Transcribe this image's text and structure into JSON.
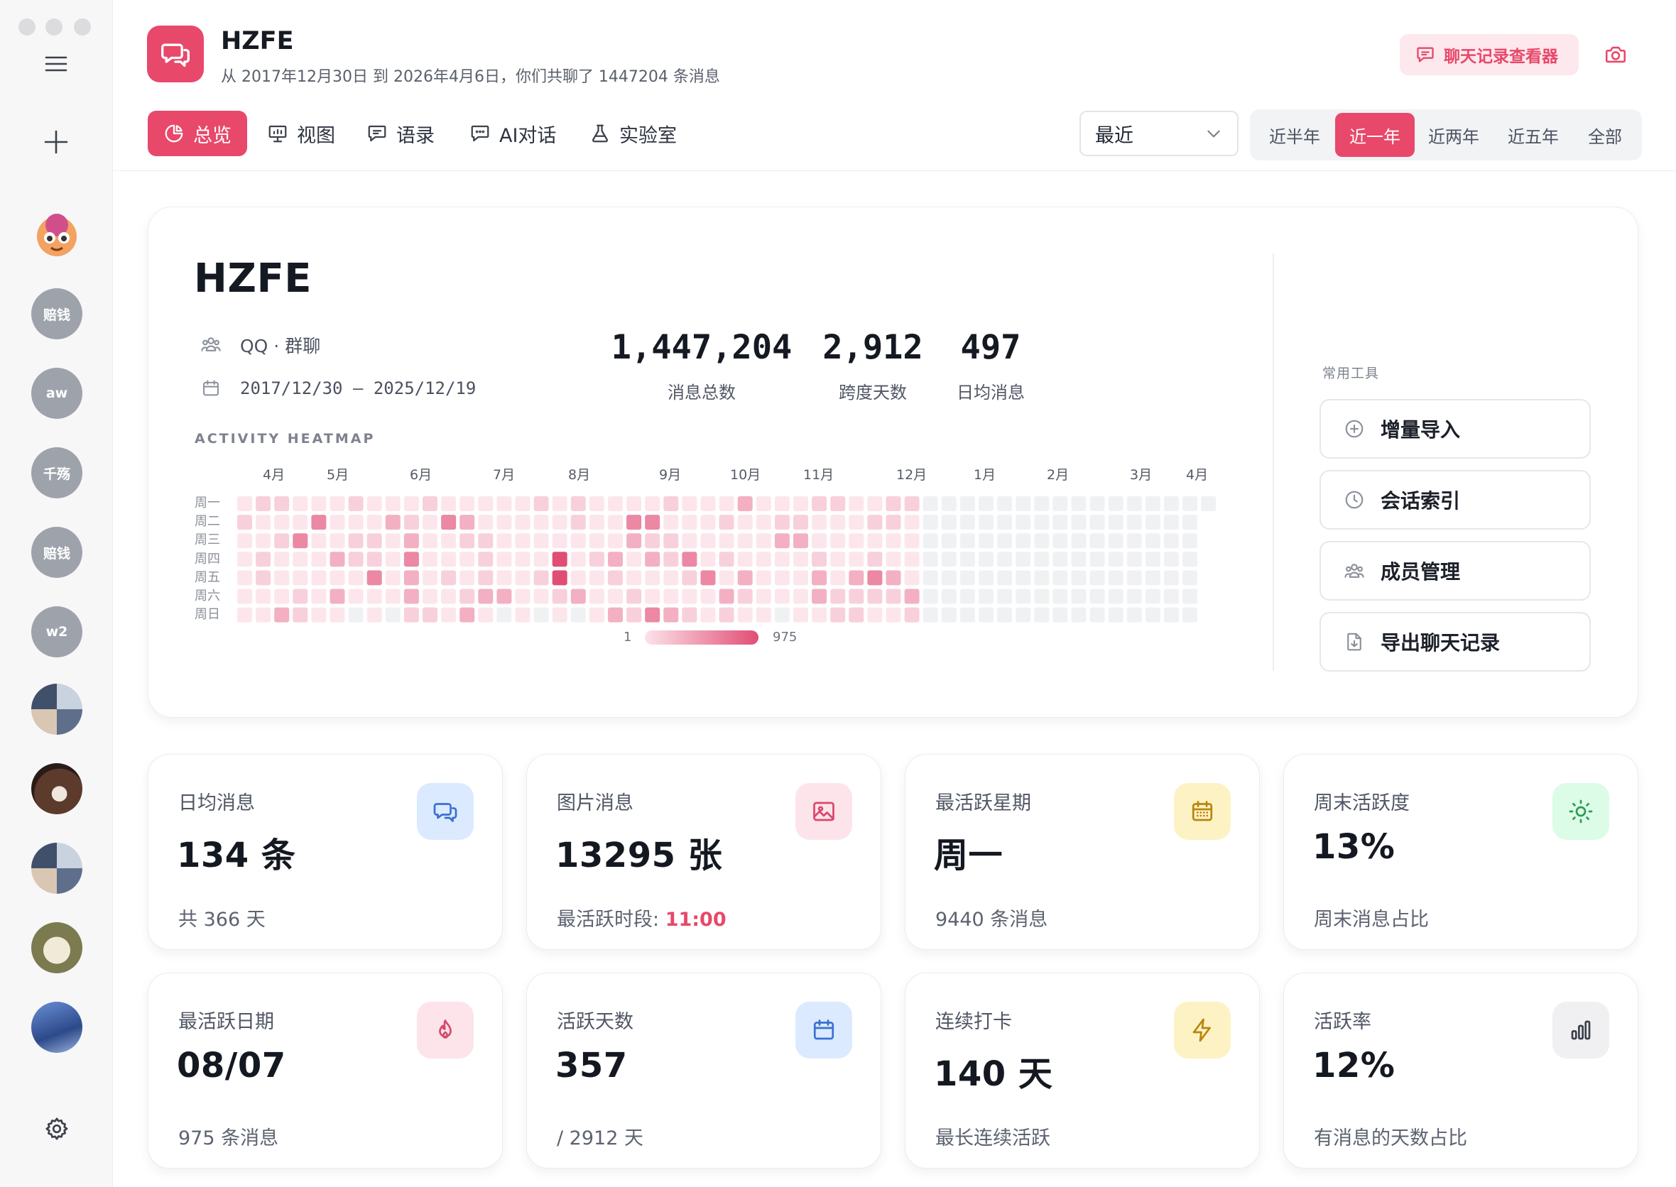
{
  "window_controls": [
    "close",
    "minimize",
    "zoom"
  ],
  "sidebar": {
    "menu_icon": "hamburger-menu-icon",
    "add_icon": "plus-icon",
    "settings_icon": "gear-icon",
    "avatars": [
      {
        "kind": "image",
        "name": "avatar-emoji-face",
        "color": "#f29a5b"
      },
      {
        "kind": "text",
        "label": "赔钱"
      },
      {
        "kind": "text",
        "label": "aw"
      },
      {
        "kind": "text",
        "label": "千殇"
      },
      {
        "kind": "text",
        "label": "赔钱"
      },
      {
        "kind": "text",
        "label": "w2"
      },
      {
        "kind": "image",
        "name": "avatar-photo-collage",
        "color": "#7b8aa6"
      },
      {
        "kind": "image",
        "name": "avatar-photo-dark",
        "color": "#4a2d24"
      },
      {
        "kind": "image",
        "name": "avatar-photo-grid",
        "color": "#6f7b6a"
      },
      {
        "kind": "image",
        "name": "avatar-photo-dog",
        "color": "#8a8a5e"
      },
      {
        "kind": "image",
        "name": "avatar-photo-sky",
        "color": "#3d5d9e"
      }
    ]
  },
  "header": {
    "app_icon": "chat-bubbles-icon",
    "title": "HZFE",
    "subtitle": "从 2017年12月30日 到 2026年4月6日，你们共聊了 1447204 条消息",
    "viewer_button": "聊天记录查看器",
    "viewer_icon": "chat-bubble-icon",
    "camera_icon": "camera-icon"
  },
  "tabs": [
    {
      "label": "总览",
      "icon": "pie-chart-icon",
      "active": true
    },
    {
      "label": "视图",
      "icon": "presentation-chart-icon",
      "active": false
    },
    {
      "label": "语录",
      "icon": "chat-bubble-icon",
      "active": false
    },
    {
      "label": "AI对话",
      "icon": "chat-dots-icon",
      "active": false
    },
    {
      "label": "实验室",
      "icon": "flask-icon",
      "active": false
    }
  ],
  "range_select": {
    "value": "最近",
    "icon": "chevron-down-icon"
  },
  "range_segments": [
    {
      "label": "近半年",
      "active": false
    },
    {
      "label": "近一年",
      "active": true
    },
    {
      "label": "近两年",
      "active": false
    },
    {
      "label": "近五年",
      "active": false
    },
    {
      "label": "全部",
      "active": false
    }
  ],
  "overview": {
    "group_name": "HZFE",
    "platform": "QQ · 群聊",
    "platform_icon": "users-icon",
    "date_range": "2017/12/30 – 2025/12/19",
    "date_icon": "calendar-icon",
    "stats": [
      {
        "value": "1,447,204",
        "label": "消息总数"
      },
      {
        "value": "2,912",
        "label": "跨度天数"
      },
      {
        "value": "497",
        "label": "日均消息"
      }
    ],
    "heatmap": {
      "title": "ACTIVITY HEATMAP",
      "months": [
        "4月",
        "5月",
        "6月",
        "7月",
        "8月",
        "9月",
        "10月",
        "11月",
        "12月",
        "1月",
        "2月",
        "3月",
        "4月"
      ],
      "weekdays": [
        "周一",
        "周二",
        "周三",
        "周四",
        "周五",
        "周六",
        "周日"
      ],
      "legend_min": "1",
      "legend_max": "975",
      "cols": 53,
      "active_cols": 37,
      "palette": [
        "#f0f1f3",
        "#fce6ec",
        "#f8d0dc",
        "#f3b0c3",
        "#ec88a4",
        "#e04e75"
      ]
    },
    "tools": {
      "heading": "常用工具",
      "items": [
        {
          "label": "增量导入",
          "icon": "plus-circle-icon"
        },
        {
          "label": "会话索引",
          "icon": "clock-icon"
        },
        {
          "label": "成员管理",
          "icon": "users-icon"
        },
        {
          "label": "导出聊天记录",
          "icon": "file-download-icon"
        }
      ]
    }
  },
  "stat_cards": [
    {
      "label": "日均消息",
      "value": "134 条",
      "sub": "共 366 天",
      "icon": "chat-bubbles-icon",
      "bg": "#dbeafe",
      "fg": "#3b6fd4"
    },
    {
      "label": "图片消息",
      "value": "13295 张",
      "sub": "最活跃时段: ",
      "sub_highlight": "11:00",
      "icon": "image-icon",
      "bg": "#fde4ea",
      "fg": "#d8486b"
    },
    {
      "label": "最活跃星期",
      "value": "周一",
      "sub": "9440 条消息",
      "icon": "calendar-grid-icon",
      "bg": "#fdf2c4",
      "fg": "#b8860b"
    },
    {
      "label": "周末活跃度",
      "value": "13%",
      "sub": "周末消息占比",
      "icon": "sun-icon",
      "bg": "#dcfce7",
      "fg": "#2f9a55"
    },
    {
      "label": "最活跃日期",
      "value": "08/07",
      "sub": "975 条消息",
      "icon": "flame-icon",
      "bg": "#fde4ea",
      "fg": "#d8486b"
    },
    {
      "label": "活跃天数",
      "value": "357",
      "sub": "/ 2912 天",
      "icon": "calendar-icon",
      "bg": "#dbeafe",
      "fg": "#3b6fd4"
    },
    {
      "label": "连续打卡",
      "value": "140 天",
      "sub": "最长连续活跃",
      "icon": "lightning-icon",
      "bg": "#fdf2c4",
      "fg": "#b8860b"
    },
    {
      "label": "活跃率",
      "value": "12%",
      "sub": "有消息的天数占比",
      "icon": "bar-chart-icon",
      "bg": "#f0f0f2",
      "fg": "#3a3f4a"
    }
  ]
}
